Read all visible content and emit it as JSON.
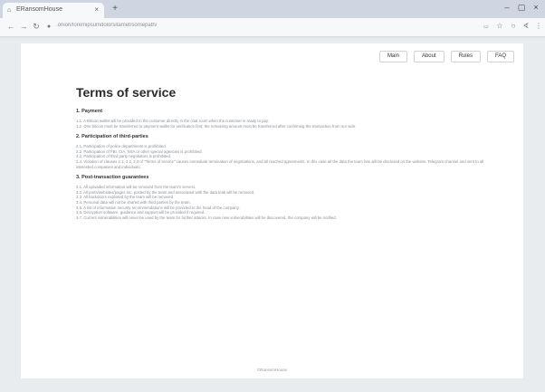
{
  "browser": {
    "tab_title": "ERansomHouse",
    "url": ".onion/loremipsumdolorsitamet/somepath/",
    "colors": {
      "titlebar": "#cfd6e1",
      "toolbar": "#f7f8fa"
    }
  },
  "nav": {
    "items": [
      "Main",
      "About",
      "Rules",
      "FAQ"
    ]
  },
  "page": {
    "title": "Terms of service",
    "sections": [
      {
        "heading": "1. Payment",
        "items": [
          "1.1. A Bitcoin wallet will be provided to the customer directly in the chat room when the customer is ready to pay.",
          "1.2. One bitcoin must be transferred to payment wallet for verification first; the remaining amount must be transferred after confirming the transaction from our side."
        ]
      },
      {
        "heading": "2. Participation of third-parties",
        "items": [
          "2.1. Participation of police departments is prohibited.",
          "2.2. Participation of FBI, CIA, NSA or other special agencies is prohibited.",
          "2.3. Participation of third party negotiators is prohibited.",
          "2.4. Violation of clauses 2.1, 2.2, 2.3 of \"Terms of service\" causes immediate termination of negotiations, and all reached agreements. In this case all the data the team has will be disclosed on the website, Telegram channel and sent to all interested companies and individuals."
        ]
      },
      {
        "heading": "3. Post-transaction guarantees",
        "items": [
          "3.1. All uploaded information will be removed from the team's servers.",
          "3.2. All ports/websites/pages etc. posted by the team and associated with the data leak will be removed.",
          "3.3. All backdoors exploited by the team will be removed.",
          "3.4. Personal data will not be shared with third parties by the team.",
          "3.5. A list of information security recommendations will be provided to the head of the company.",
          "3.6. Decryption software, guidance and support will be provided if required.",
          "3.7. Current vulnerabilities will never be used by the team for further attacks. In case new vulnerabilities will be discovered, the company will be notified."
        ]
      }
    ],
    "footer": "©RansomHouse"
  }
}
